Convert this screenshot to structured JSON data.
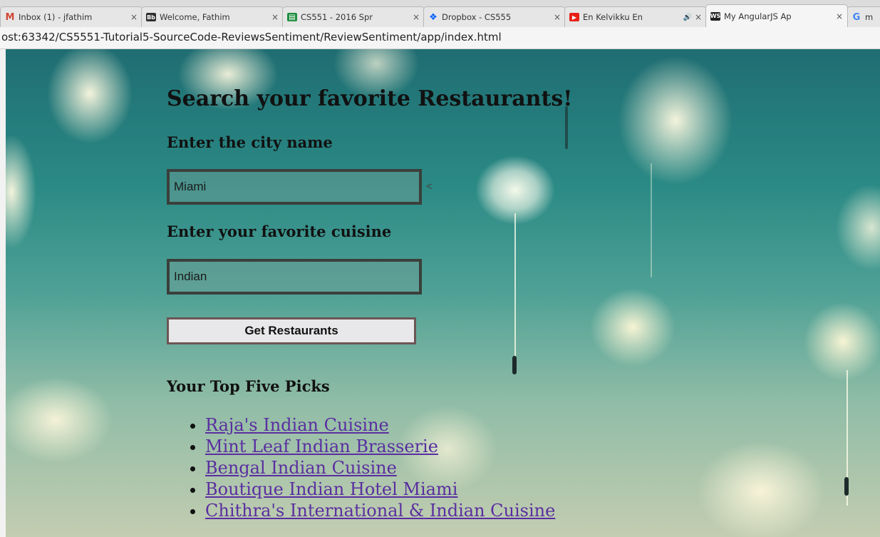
{
  "browser": {
    "tabs": [
      {
        "title": "Inbox (1) - jfathim",
        "favicon": "gmail-icon",
        "badge": "M",
        "color": "#d14836",
        "active": false
      },
      {
        "title": "Welcome, Fathim",
        "favicon": "blackboard-icon",
        "badge": "Bb",
        "color": "#2f2f2f",
        "active": false
      },
      {
        "title": "CS551 - 2016 Spr",
        "favicon": "sheets-icon",
        "badge": "▤",
        "color": "#1e8e3e",
        "active": false
      },
      {
        "title": "Dropbox - CS555",
        "favicon": "dropbox-icon",
        "badge": "❖",
        "color": "#0061fe",
        "active": false
      },
      {
        "title": "En Kelvikku En",
        "favicon": "youtube-icon",
        "badge": "▶",
        "color": "#e62117",
        "active": false
      },
      {
        "title": "My AngularJS Ap",
        "favicon": "webstorm-icon",
        "badge": "WS",
        "color": "#222222",
        "active": true
      },
      {
        "title": "m",
        "favicon": "google-icon",
        "badge": "G",
        "color": "#4285f4",
        "active": false
      }
    ],
    "tab_close_glyph": "×",
    "audio_glyph": "🔊",
    "url": "ost:63342/CS5551-Tutorial5-SourceCode-ReviewsSentiment/ReviewSentiment/app/index.html"
  },
  "page": {
    "title": "Search your favorite Restaurants!",
    "city_label": "Enter the city name",
    "city_value": "Miami",
    "stray_text": "<",
    "cuisine_label": "Enter your favorite cuisine",
    "cuisine_value": "Indian",
    "button_label": "Get Restaurants",
    "picks_heading": "Your Top Five Picks",
    "picks": [
      "Raja's Indian Cuisine",
      "Mint Leaf Indian Brasserie",
      "Bengal Indian Cuisine",
      "Boutique Indian Hotel Miami",
      "Chithra's International & Indian Cuisine"
    ]
  },
  "colors": {
    "link": "#5a2ea0",
    "input_border": "#3b3f3b",
    "button_border": "#6d5555"
  }
}
